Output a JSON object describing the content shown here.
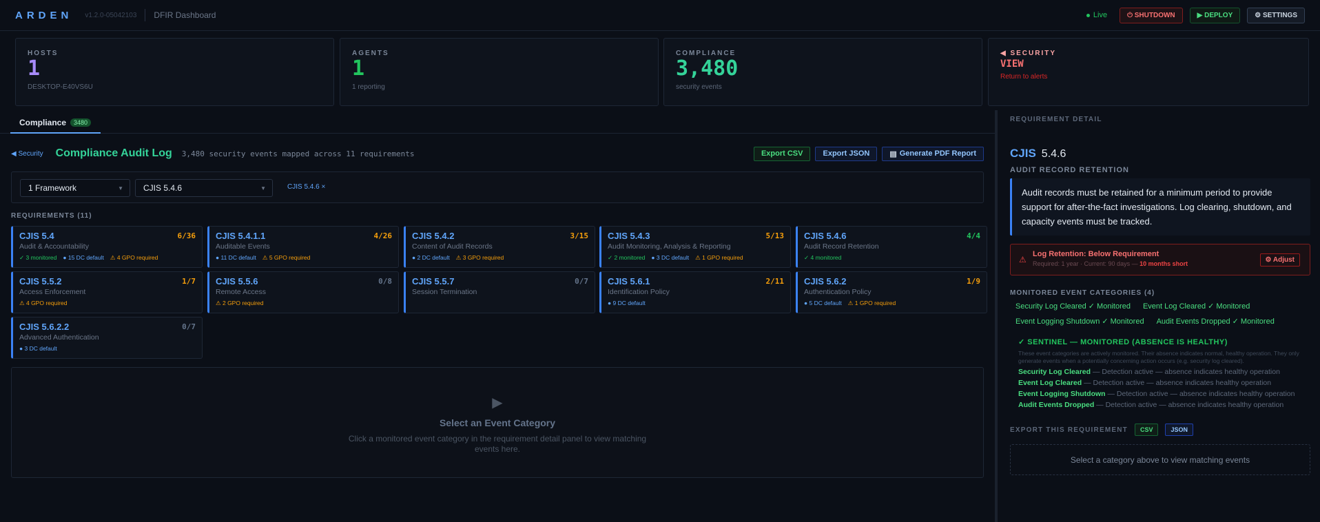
{
  "app": {
    "brand": "ARDEN",
    "version": "v1.2.0-05042103",
    "title": "DFIR Dashboard"
  },
  "topbar": {
    "live": "Live",
    "shutdown": "⏻ SHUTDOWN",
    "deploy": "▶ DEPLOY",
    "settings": "⚙ SETTINGS"
  },
  "stats": {
    "hosts": {
      "label": "HOSTS",
      "value": "1",
      "sub": "DESKTOP-E40VS6U"
    },
    "agents": {
      "label": "AGENTS",
      "value": "1",
      "sub": "1 reporting"
    },
    "compliance": {
      "label": "COMPLIANCE",
      "value": "3,480",
      "sub": "security events"
    },
    "security": {
      "label": "◀ SECURITY",
      "value": "VIEW",
      "sub": "Return to alerts"
    }
  },
  "tab": {
    "label": "Compliance",
    "count": "3480"
  },
  "header": {
    "back": "◀ Security",
    "title": "Compliance Audit Log",
    "subtitle": "3,480 security events mapped across 11 requirements",
    "export_csv": "Export CSV",
    "export_json": "Export JSON",
    "pdf": "Generate PDF Report"
  },
  "filters": {
    "framework": "1 Framework",
    "requirement": "CJIS 5.4.6",
    "chip": "CJIS 5.4.6 ×"
  },
  "requirements_label": "REQUIREMENTS (11)",
  "requirements": [
    {
      "id": "CJIS 5.4",
      "name": "Audit & Accountability",
      "count": "6/36",
      "mon": "✓ 3 monitored",
      "dc": "● 15 DC default",
      "gpo": "⚠ 4 GPO required"
    },
    {
      "id": "CJIS 5.4.1.1",
      "name": "Auditable Events",
      "count": "4/26",
      "mon": "",
      "dc": "● 11 DC default",
      "gpo": "⚠ 5 GPO required"
    },
    {
      "id": "CJIS 5.4.2",
      "name": "Content of Audit Records",
      "count": "3/15",
      "mon": "",
      "dc": "● 2 DC default",
      "gpo": "⚠ 3 GPO required"
    },
    {
      "id": "CJIS 5.4.3",
      "name": "Audit Monitoring, Analysis & Reporting",
      "count": "5/13",
      "mon": "✓ 2 monitored",
      "dc": "● 3 DC default",
      "gpo": "⚠ 1 GPO required"
    },
    {
      "id": "CJIS 5.4.6",
      "name": "Audit Record Retention",
      "count": "4/4",
      "mon": "✓ 4 monitored",
      "dc": "",
      "gpo": ""
    },
    {
      "id": "CJIS 5.5.2",
      "name": "Access Enforcement",
      "count": "1/7",
      "mon": "",
      "dc": "",
      "gpo": "⚠ 4 GPO required"
    },
    {
      "id": "CJIS 5.5.6",
      "name": "Remote Access",
      "count": "0/8",
      "mon": "",
      "dc": "",
      "gpo": "⚠ 2 GPO required"
    },
    {
      "id": "CJIS 5.5.7",
      "name": "Session Termination",
      "count": "0/7",
      "mon": "",
      "dc": "",
      "gpo": ""
    },
    {
      "id": "CJIS 5.6.1",
      "name": "Identification Policy",
      "count": "2/11",
      "mon": "",
      "dc": "● 9 DC default",
      "gpo": ""
    },
    {
      "id": "CJIS 5.6.2",
      "name": "Authentication Policy",
      "count": "1/9",
      "mon": "",
      "dc": "● 5 DC default",
      "gpo": "⚠ 1 GPO required"
    },
    {
      "id": "CJIS 5.6.2.2",
      "name": "Advanced Authentication",
      "count": "0/7",
      "mon": "",
      "dc": "● 3 DC default",
      "gpo": ""
    }
  ],
  "empty": {
    "title": "Select an Event Category",
    "text": "Click a monitored event category in the requirement detail panel to view matching events here."
  },
  "detail": {
    "heading": "REQUIREMENT DETAIL",
    "framework": "CJIS",
    "id": "5.4.6",
    "name": "AUDIT RECORD RETENTION",
    "description": "Audit records must be retained for a minimum period to provide support for after-the-fact investigations. Log clearing, shutdown, and capacity events must be tracked.",
    "warn_title": "Log Retention: Below Requirement",
    "warn_sub": "Required: 1 year · Current: 90 days —",
    "warn_short": "10 months short",
    "adjust": "⚙ Adjust",
    "cats_heading": "MONITORED EVENT CATEGORIES (4)",
    "cats": [
      "Security Log Cleared ✓ Monitored",
      "Event Log Cleared ✓ Monitored",
      "Event Logging Shutdown ✓ Monitored",
      "Audit Events Dropped ✓ Monitored"
    ],
    "sentinel_title": "✓ SENTINEL — MONITORED (ABSENCE IS HEALTHY)",
    "sentinel_desc": "These event categories are actively monitored. Their absence indicates normal, healthy operation. They only generate events when a potentially concerning action occurs (e.g. security log cleared).",
    "sentinel_items": [
      {
        "name": "Security Log Cleared",
        "text": " — Detection active — absence indicates healthy operation"
      },
      {
        "name": "Event Log Cleared",
        "text": " — Detection active — absence indicates healthy operation"
      },
      {
        "name": "Event Logging Shutdown",
        "text": " — Detection active — absence indicates healthy operation"
      },
      {
        "name": "Audit Events Dropped",
        "text": " — Detection active — absence indicates healthy operation"
      }
    ],
    "export_label": "EXPORT THIS REQUIREMENT",
    "csv": "CSV",
    "json": "JSON",
    "select_hint": "Select a category above to view matching events"
  },
  "colors": {
    "accent": "#60a5fa",
    "success": "#34d399",
    "warning": "#f59e0b",
    "danger": "#ef4444",
    "agents": "#22c55e",
    "hosts": "#a78bfa"
  }
}
